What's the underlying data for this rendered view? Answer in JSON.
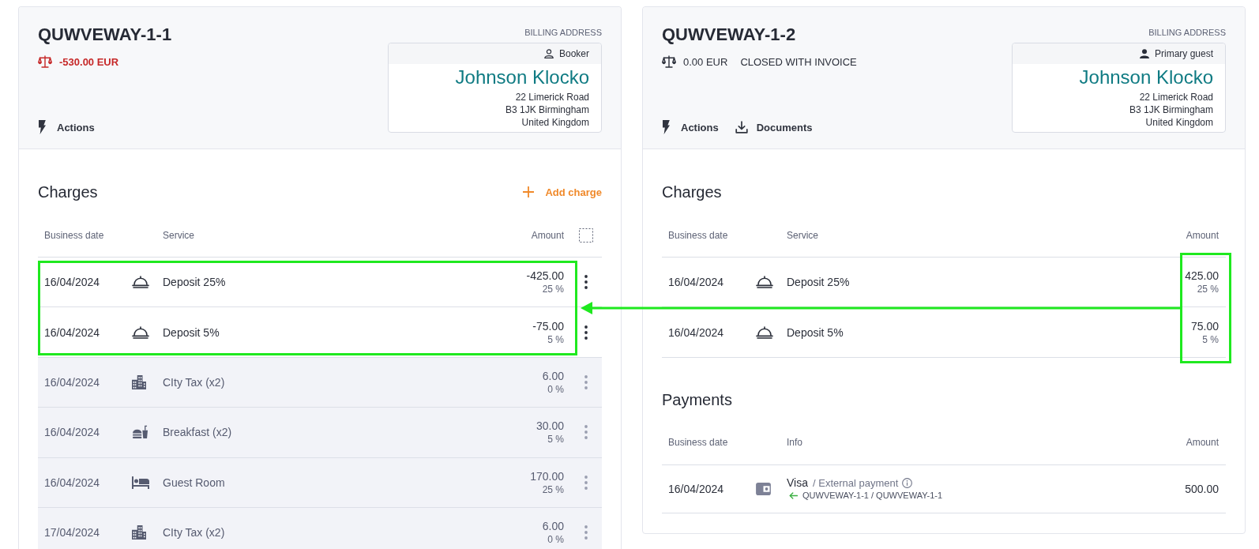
{
  "folios": [
    {
      "title": "QUWVEWAY-1-1",
      "balance": {
        "amount": "-530.00 EUR",
        "negative": true
      },
      "billing": {
        "label": "BILLING ADDRESS",
        "kind": "booker",
        "role": "Booker",
        "name": "Johnson Klocko",
        "lines": [
          "22 Limerick Road",
          "B3 1JK Birmingham",
          "United Kingdom"
        ]
      },
      "actions": [
        {
          "kind": "menu",
          "label": "Actions"
        }
      ],
      "charges": {
        "title": "Charges",
        "add_button": "Add charge",
        "select_column": true,
        "row_menus": true,
        "highlight": {
          "kind": "row"
        },
        "columns": [
          "Business date",
          "Service",
          "Amount"
        ],
        "rows": [
          {
            "date": "16/04/2024",
            "kind": "deposit",
            "service": "Deposit 25%",
            "amount": "-425.00",
            "vat": "25 %",
            "disabled": false,
            "highlighted": true
          },
          {
            "date": "16/04/2024",
            "kind": "deposit",
            "service": "Deposit 5%",
            "amount": "-75.00",
            "vat": "5 %",
            "disabled": false,
            "highlighted": true
          },
          {
            "date": "16/04/2024",
            "kind": "tax",
            "service": "CIty Tax (x2)",
            "amount": "6.00",
            "vat": "0 %",
            "disabled": true,
            "highlighted": false
          },
          {
            "date": "16/04/2024",
            "kind": "food",
            "service": "Breakfast (x2)",
            "amount": "30.00",
            "vat": "5 %",
            "disabled": true,
            "highlighted": false
          },
          {
            "date": "16/04/2024",
            "kind": "accommodation",
            "service": "Guest Room",
            "amount": "170.00",
            "vat": "25 %",
            "disabled": true,
            "highlighted": false
          },
          {
            "date": "17/04/2024",
            "kind": "tax",
            "service": "CIty Tax (x2)",
            "amount": "6.00",
            "vat": "0 %",
            "disabled": true,
            "highlighted": false
          }
        ]
      }
    },
    {
      "title": "QUWVEWAY-1-2",
      "balance": {
        "amount": "0.00 EUR",
        "negative": false,
        "status": "CLOSED WITH INVOICE"
      },
      "billing": {
        "label": "BILLING ADDRESS",
        "kind": "primary-guest",
        "role": "Primary guest",
        "name": "Johnson Klocko",
        "lines": [
          "22 Limerick Road",
          "B3 1JK Birmingham",
          "United Kingdom"
        ]
      },
      "actions": [
        {
          "kind": "menu",
          "label": "Actions"
        },
        {
          "kind": "download",
          "label": "Documents"
        }
      ],
      "charges": {
        "title": "Charges",
        "select_column": false,
        "row_menus": false,
        "highlight": {
          "kind": "amount"
        },
        "columns": [
          "Business date",
          "Service",
          "Amount"
        ],
        "rows": [
          {
            "date": "16/04/2024",
            "kind": "deposit",
            "service": "Deposit 25%",
            "amount": "425.00",
            "vat": "25 %",
            "disabled": false,
            "highlighted": true
          },
          {
            "date": "16/04/2024",
            "kind": "deposit",
            "service": "Deposit 5%",
            "amount": "75.00",
            "vat": "5 %",
            "disabled": false,
            "highlighted": true
          }
        ]
      },
      "payments": {
        "title": "Payments",
        "columns": [
          "Business date",
          "Info",
          "Amount"
        ],
        "rows": [
          {
            "date": "16/04/2024",
            "method": "Visa",
            "type": "/ External payment",
            "source": "QUWVEWAY-1-1 / QUWVEWAY-1-1",
            "amount": "500.00"
          }
        ]
      }
    }
  ],
  "link_arrow": true
}
